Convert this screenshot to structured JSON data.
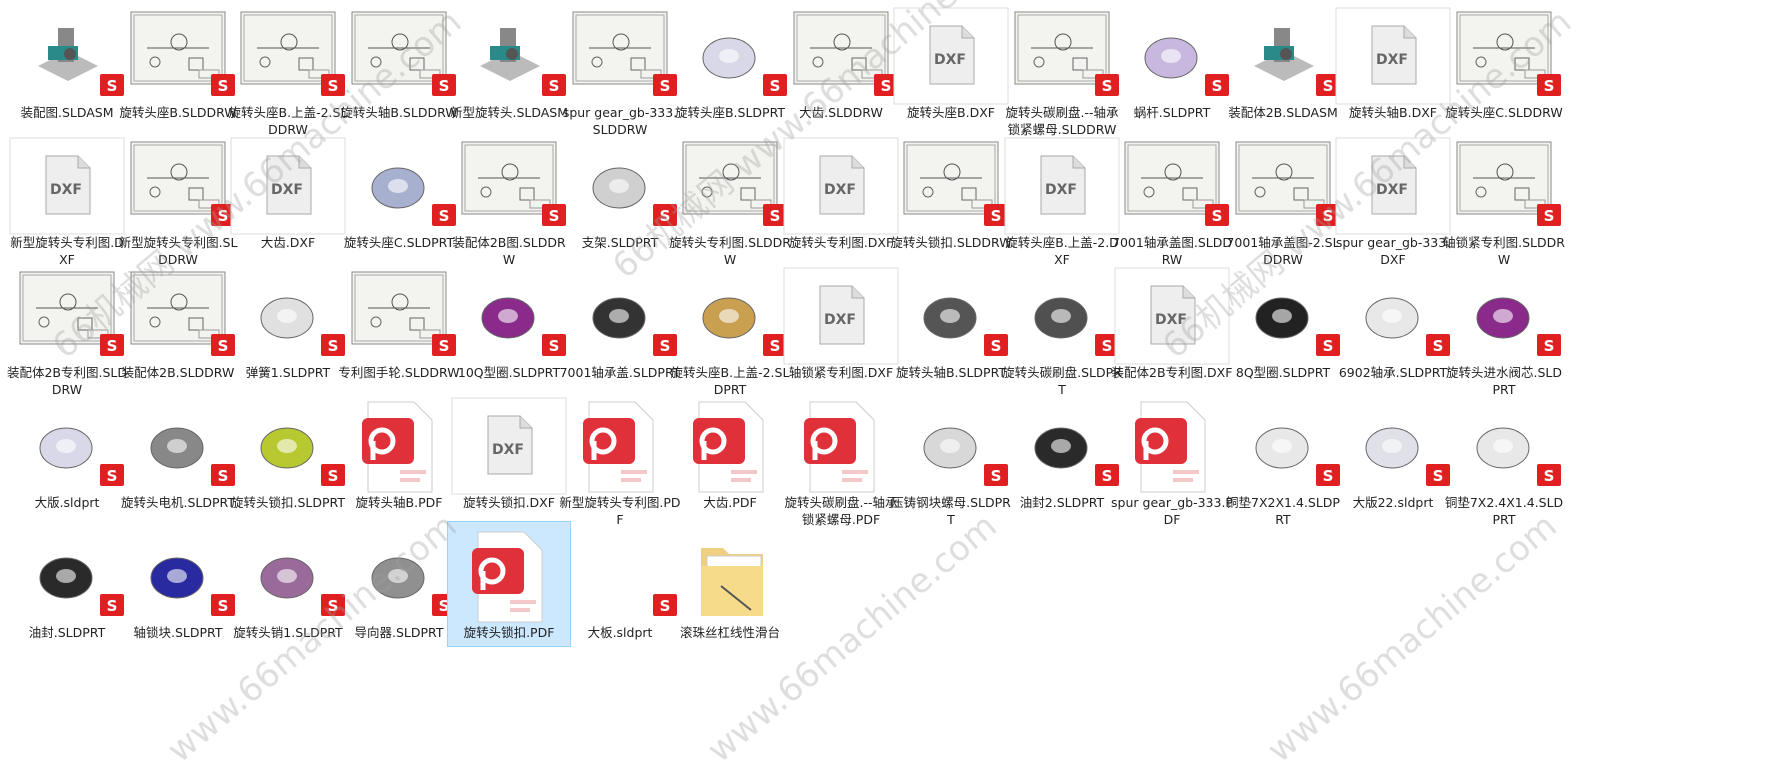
{
  "files": [
    {
      "name": "装配图.SLDASM",
      "type": "asm3d"
    },
    {
      "name": "旋转头座B.SLDDRW",
      "type": "drawing"
    },
    {
      "name": "旋转头座B.上盖-2.SLDDRW",
      "type": "drawing"
    },
    {
      "name": "旋转头轴B.SLDDRW",
      "type": "drawing"
    },
    {
      "name": "新型旋转头.SLDASM",
      "type": "asm3d"
    },
    {
      "name": "spur gear_gb-333.SLDDRW",
      "type": "drawing"
    },
    {
      "name": "旋转头座B.SLDPRT",
      "type": "part",
      "color": "#d8d8e8"
    },
    {
      "name": "大齿.SLDDRW",
      "type": "drawing"
    },
    {
      "name": "旋转头座B.DXF",
      "type": "dxf"
    },
    {
      "name": "旋转头碳刷盘.--轴承锁紧螺母.SLDDRW",
      "type": "drawing"
    },
    {
      "name": "蜗杆.SLDPRT",
      "type": "part",
      "color": "#c8b8e0"
    },
    {
      "name": "装配体2B.SLDASM",
      "type": "asm3d"
    },
    {
      "name": "旋转头轴B.DXF",
      "type": "dxf"
    },
    {
      "name": "旋转头座C.SLDDRW",
      "type": "drawing"
    },
    {
      "name": "新型旋转头专利图.DXF",
      "type": "dxf"
    },
    {
      "name": "新型旋转头专利图.SLDDRW",
      "type": "drawing"
    },
    {
      "name": "大齿.DXF",
      "type": "dxf"
    },
    {
      "name": "旋转头座C.SLDPRT",
      "type": "part",
      "color": "#a8b0d0"
    },
    {
      "name": "装配体2B图.SLDDRW",
      "type": "drawing"
    },
    {
      "name": "支架.SLDPRT",
      "type": "part",
      "color": "#d0d0d0"
    },
    {
      "name": "旋转头专利图.SLDDRW",
      "type": "drawing"
    },
    {
      "name": "旋转头专利图.DXF",
      "type": "dxf"
    },
    {
      "name": "旋转头锁扣.SLDDRW",
      "type": "drawing"
    },
    {
      "name": "旋转头座B.上盖-2.DXF",
      "type": "dxf"
    },
    {
      "name": "7001轴承盖图.SLDDRW",
      "type": "drawing"
    },
    {
      "name": "7001轴承盖图-2.SLDDRW",
      "type": "drawing"
    },
    {
      "name": "spur gear_gb-333.DXF",
      "type": "dxf"
    },
    {
      "name": "轴锁紧专利图.SLDDRW",
      "type": "drawing"
    },
    {
      "name": "装配体2B专利图.SLDDRW",
      "type": "drawing"
    },
    {
      "name": "装配体2B.SLDDRW",
      "type": "drawing"
    },
    {
      "name": "弹簧1.SLDPRT",
      "type": "part",
      "color": "#e0e0e0"
    },
    {
      "name": "专利图手轮.SLDDRW",
      "type": "drawing"
    },
    {
      "name": "10Q型圈.SLDPRT",
      "type": "part",
      "color": "#8a2a8a"
    },
    {
      "name": "7001轴承盖.SLDPRT",
      "type": "part",
      "color": "#333333"
    },
    {
      "name": "旋转头座B.上盖-2.SLDPRT",
      "type": "part",
      "color": "#c8a050"
    },
    {
      "name": "轴锁紧专利图.DXF",
      "type": "dxf"
    },
    {
      "name": "旋转头轴B.SLDPRT",
      "type": "part",
      "color": "#555555"
    },
    {
      "name": "旋转头碳刷盘.SLDPRT",
      "type": "part",
      "color": "#505050"
    },
    {
      "name": "装配体2B专利图.DXF",
      "type": "dxf"
    },
    {
      "name": "8Q型圈.SLDPRT",
      "type": "part",
      "color": "#222222"
    },
    {
      "name": "6902轴承.SLDPRT",
      "type": "part",
      "color": "#e8e8e8"
    },
    {
      "name": "旋转头进水阀芯.SLDPRT",
      "type": "part",
      "color": "#8a2a8a"
    },
    {
      "name": "大版.sldprt",
      "type": "part",
      "color": "#d8d8e8"
    },
    {
      "name": "旋转头电机.SLDPRT",
      "type": "part",
      "color": "#888888"
    },
    {
      "name": "旋转头锁扣.SLDPRT",
      "type": "part",
      "color": "#b8c830"
    },
    {
      "name": "旋转头轴B.PDF",
      "type": "pdf"
    },
    {
      "name": "旋转头锁扣.DXF",
      "type": "dxf"
    },
    {
      "name": "新型旋转头专利图.PDF",
      "type": "pdf"
    },
    {
      "name": "大齿.PDF",
      "type": "pdf"
    },
    {
      "name": "旋转头碳刷盘.--轴承锁紧螺母.PDF",
      "type": "pdf"
    },
    {
      "name": "压铸钢块螺母.SLDPRT",
      "type": "part",
      "color": "#d8d8d8"
    },
    {
      "name": "油封2.SLDPRT",
      "type": "part",
      "color": "#2a2a2a"
    },
    {
      "name": "spur gear_gb-333.PDF",
      "type": "pdf"
    },
    {
      "name": "铜垫7X2X1.4.SLDPRT",
      "type": "part",
      "color": "#e8e8e8"
    },
    {
      "name": "大版22.sldprt",
      "type": "part",
      "color": "#e0e0e8"
    },
    {
      "name": "铜垫7X2.4X1.4.SLDPRT",
      "type": "part",
      "color": "#e8e8e8"
    },
    {
      "name": "油封.SLDPRT",
      "type": "part",
      "color": "#2a2a2a"
    },
    {
      "name": "轴锁块.SLDPRT",
      "type": "part",
      "color": "#2a2aa0"
    },
    {
      "name": "旋转头销1.SLDPRT",
      "type": "part",
      "color": "#9a6a9a"
    },
    {
      "name": "导向器.SLDPRT",
      "type": "part",
      "color": "#909090"
    },
    {
      "name": "旋转头锁扣.PDF",
      "type": "pdf",
      "selected": true
    },
    {
      "name": "大板.sldprt",
      "type": "blank"
    },
    {
      "name": "滚珠丝杠线性滑台",
      "type": "folder"
    }
  ],
  "watermarks": [
    "66机械网 www.66machine.com",
    "66机械网 www.66machine.com",
    "66机械网 www.66machine.com",
    "www.66machine.com",
    "www.66machine.com",
    "www.66machine.com"
  ]
}
